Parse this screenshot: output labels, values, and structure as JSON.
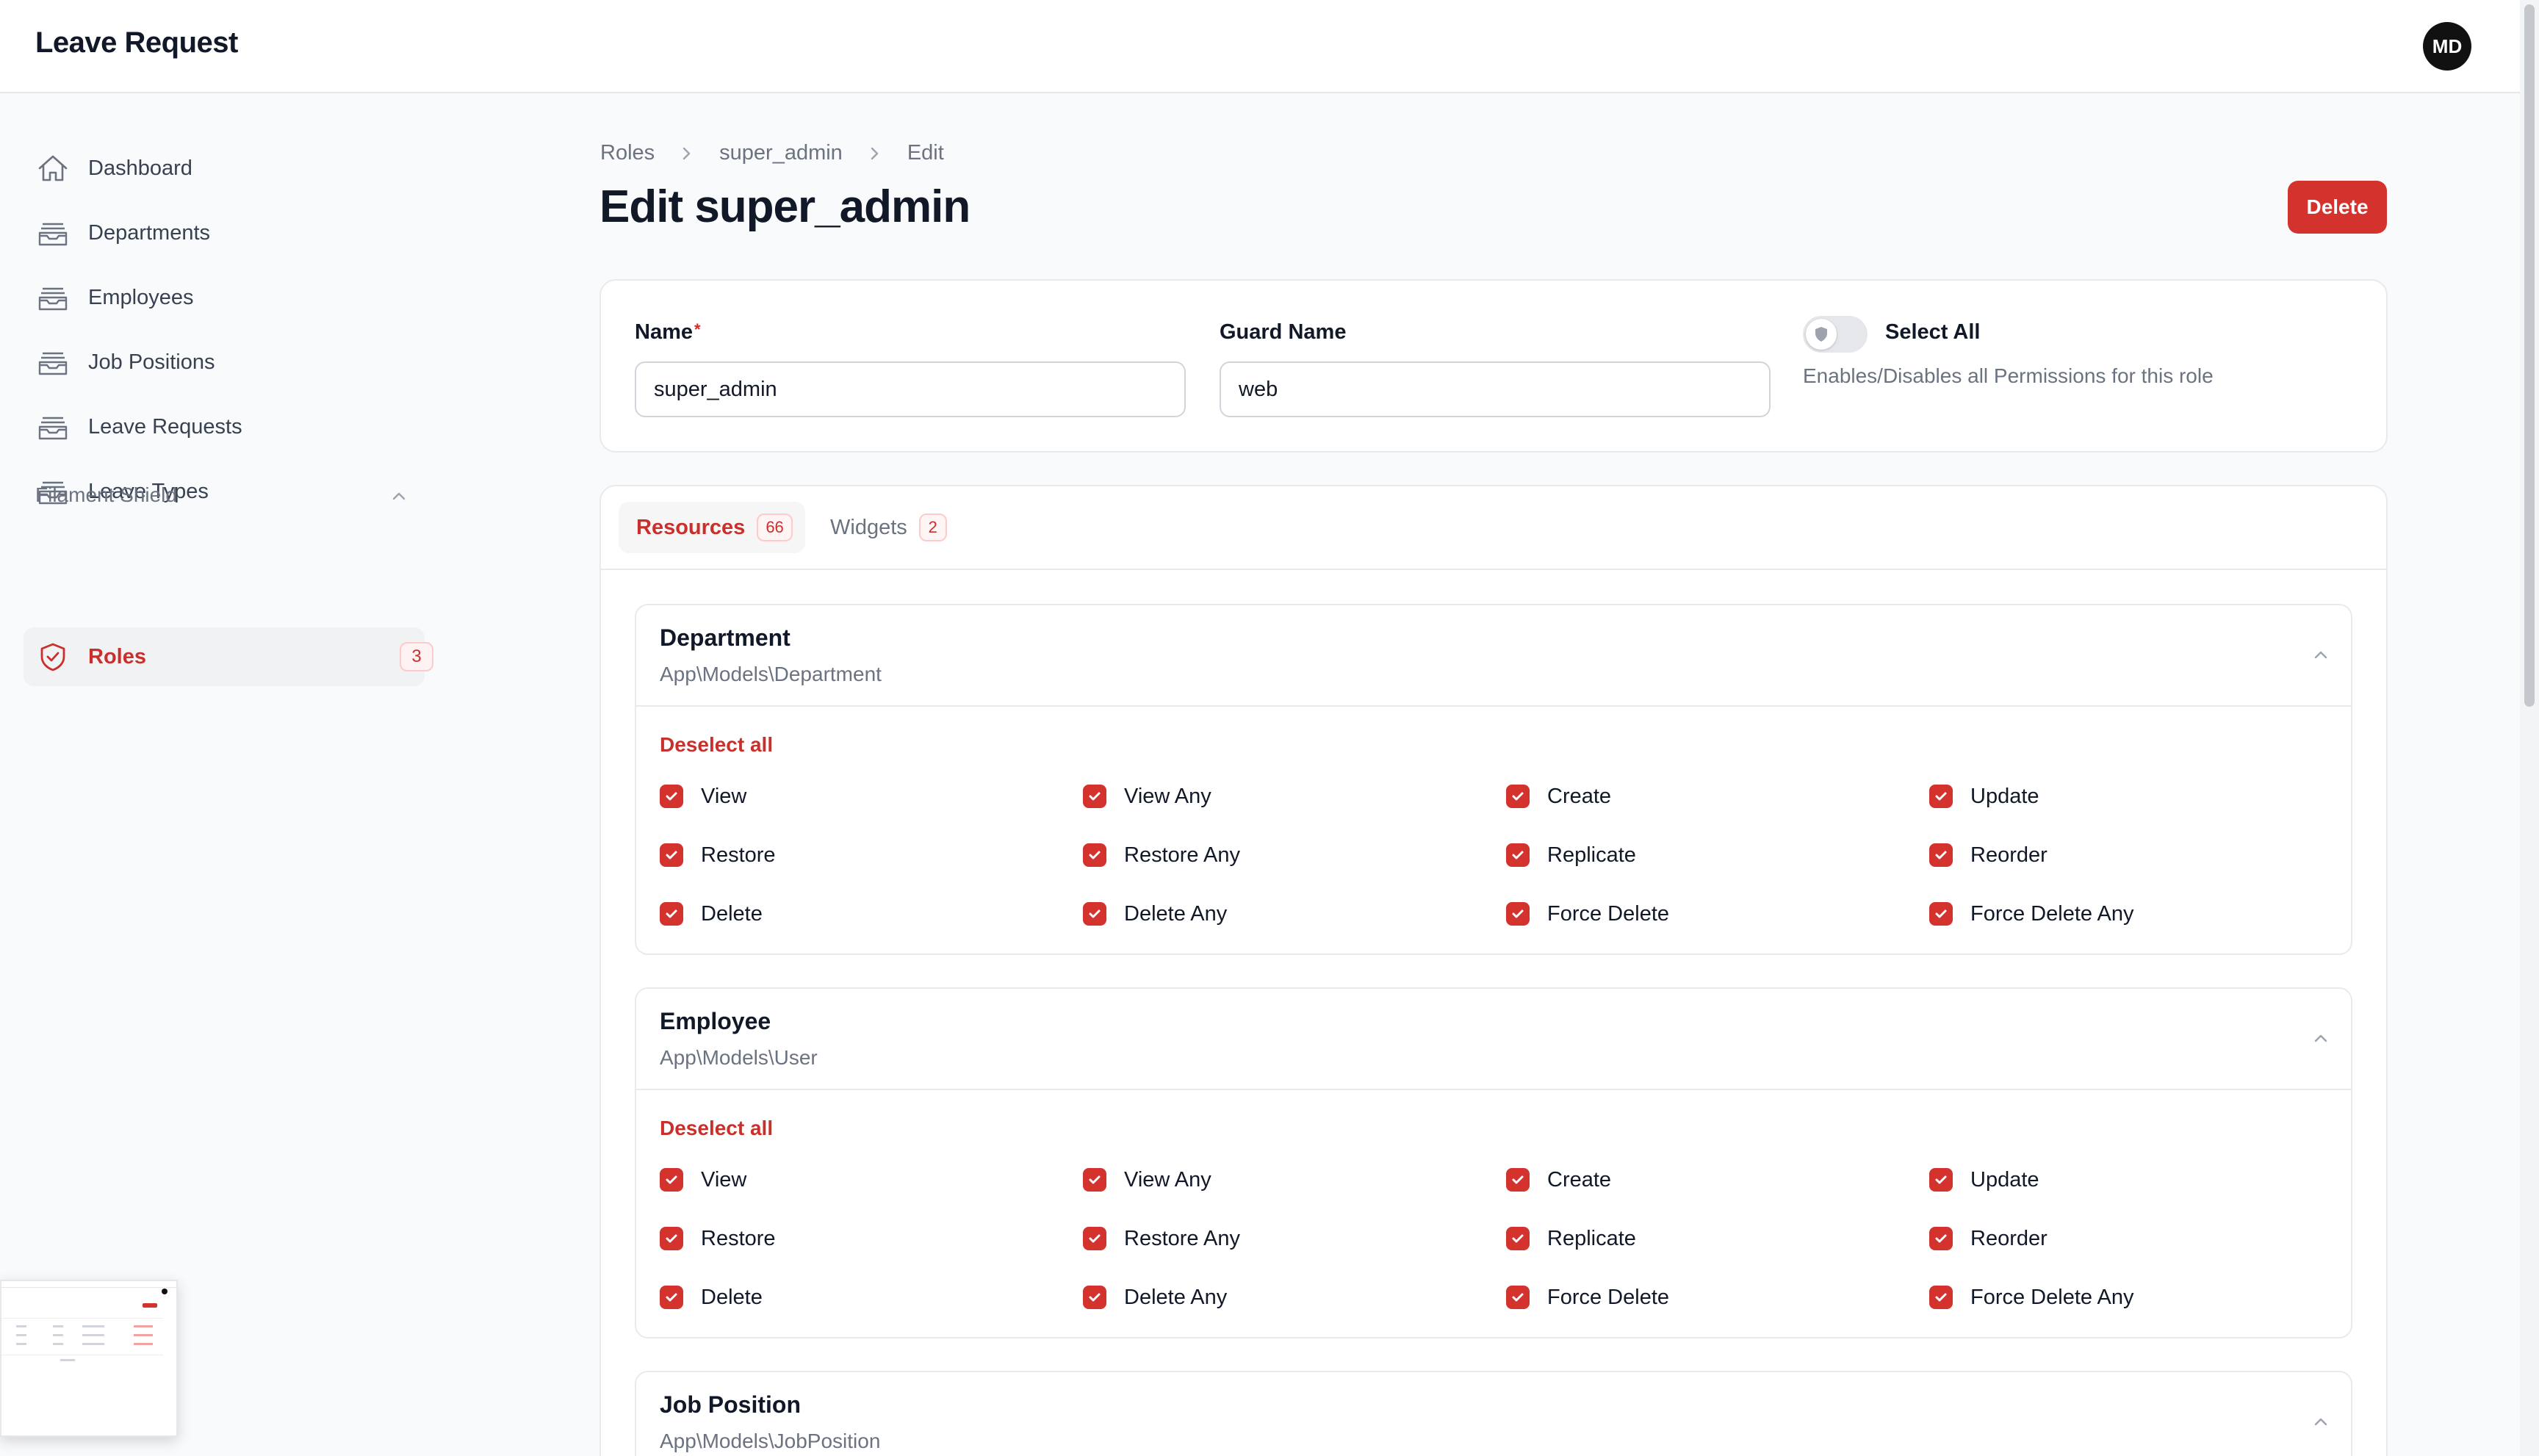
{
  "app": {
    "title": "Leave Request",
    "avatar_initials": "MD"
  },
  "sidebar": {
    "items": [
      {
        "label": "Dashboard",
        "icon": "home-icon"
      },
      {
        "label": "Departments",
        "icon": "inbox-stack-icon"
      },
      {
        "label": "Employees",
        "icon": "inbox-stack-icon"
      },
      {
        "label": "Job Positions",
        "icon": "inbox-stack-icon"
      },
      {
        "label": "Leave Requests",
        "icon": "inbox-stack-icon"
      },
      {
        "label": "Leave Types",
        "icon": "inbox-stack-icon"
      }
    ],
    "group": {
      "label": "Filament Shield",
      "items": [
        {
          "label": "Roles",
          "badge": "3",
          "icon": "shield-check-icon"
        }
      ]
    }
  },
  "breadcrumb": [
    "Roles",
    "super_admin",
    "Edit"
  ],
  "page": {
    "title": "Edit super_admin",
    "delete_label": "Delete"
  },
  "form": {
    "name": {
      "label": "Name",
      "required_mark": "*",
      "value": "super_admin"
    },
    "guard": {
      "label": "Guard Name",
      "value": "web"
    },
    "select_all": {
      "label": "Select All",
      "help": "Enables/Disables all Permissions for this role",
      "checked": false
    }
  },
  "tabs": [
    {
      "label": "Resources",
      "count": "66",
      "active": true
    },
    {
      "label": "Widgets",
      "count": "2",
      "active": false
    }
  ],
  "sections": [
    {
      "title": "Department",
      "subtitle": "App\\Models\\Department",
      "deselect_label": "Deselect all",
      "permissions": [
        "View",
        "View Any",
        "Create",
        "Update",
        "Restore",
        "Restore Any",
        "Replicate",
        "Reorder",
        "Delete",
        "Delete Any",
        "Force Delete",
        "Force Delete Any"
      ]
    },
    {
      "title": "Employee",
      "subtitle": "App\\Models\\User",
      "deselect_label": "Deselect all",
      "permissions": [
        "View",
        "View Any",
        "Create",
        "Update",
        "Restore",
        "Restore Any",
        "Replicate",
        "Reorder",
        "Delete",
        "Delete Any",
        "Force Delete",
        "Force Delete Any"
      ]
    },
    {
      "title": "Job Position",
      "subtitle": "App\\Models\\JobPosition"
    }
  ],
  "colors": {
    "accent": "#d4322c",
    "text": "#111827",
    "muted": "#6b7280"
  }
}
